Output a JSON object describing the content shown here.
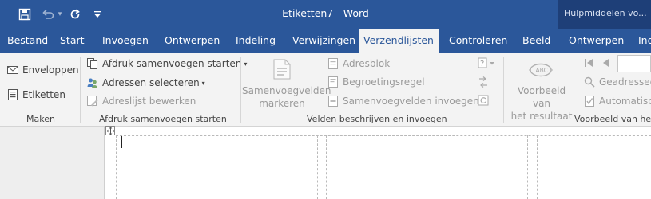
{
  "window": {
    "title": "Etiketten7  -  Word",
    "tools_context_label": "Hulpmiddelen vo..."
  },
  "quick_access": {
    "save_icon": "save-icon",
    "undo_icon": "undo-icon",
    "redo_icon": "redo-icon",
    "customize_icon": "customize-qat-icon"
  },
  "tabs": [
    {
      "label": "Bestand"
    },
    {
      "label": "Start"
    },
    {
      "label": "Invoegen"
    },
    {
      "label": "Ontwerpen"
    },
    {
      "label": "Indeling"
    },
    {
      "label": "Verwijzingen"
    },
    {
      "label": "Verzendlijsten"
    },
    {
      "label": "Controleren"
    },
    {
      "label": "Beeld"
    },
    {
      "label": "Ontwerpen"
    },
    {
      "label": "Ind"
    }
  ],
  "active_tab": "Verzendlijsten",
  "ribbon": {
    "make": {
      "envelopes": "Enveloppen",
      "labels": "Etiketten",
      "group_label": "Maken"
    },
    "start_merge": {
      "start": "Afdruk samenvoegen starten",
      "select": "Adressen selecteren",
      "edit_list": "Adreslijst bewerken",
      "group_label": "Afdruk samenvoegen starten"
    },
    "fields": {
      "highlight_line1": "Samenvoegvelden",
      "highlight_line2": "markeren",
      "address_block": "Adresblok",
      "greeting_line": "Begroetingsregel",
      "insert_field": "Samenvoegvelden invoegen",
      "group_label": "Velden beschrijven en invoegen"
    },
    "preview": {
      "preview_line1": "Voorbeeld van",
      "preview_line2": "het resultaat",
      "find_recipient": "Geadresseerd",
      "auto_check": "Automatisch",
      "group_label": "Voorbeeld van het"
    }
  },
  "colors": {
    "accent": "#2b579a",
    "tools_context": "#1e3f78",
    "ribbon_bg": "#f3f3f3"
  }
}
